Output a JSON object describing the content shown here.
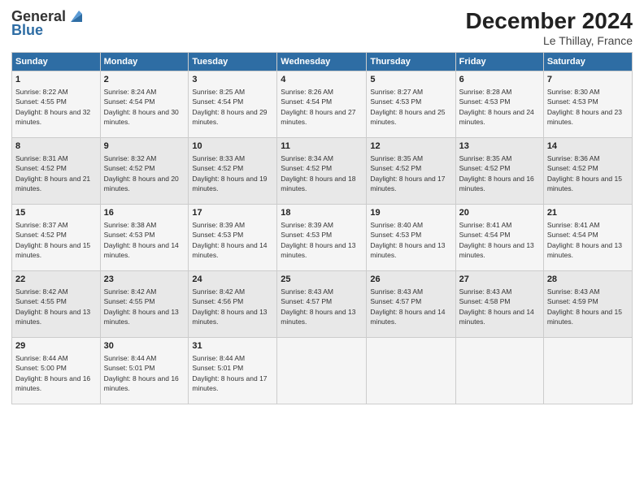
{
  "header": {
    "logo_line1": "General",
    "logo_line2": "Blue",
    "month": "December 2024",
    "location": "Le Thillay, France"
  },
  "weekdays": [
    "Sunday",
    "Monday",
    "Tuesday",
    "Wednesday",
    "Thursday",
    "Friday",
    "Saturday"
  ],
  "weeks": [
    [
      {
        "day": "1",
        "sunrise": "Sunrise: 8:22 AM",
        "sunset": "Sunset: 4:55 PM",
        "daylight": "Daylight: 8 hours and 32 minutes."
      },
      {
        "day": "2",
        "sunrise": "Sunrise: 8:24 AM",
        "sunset": "Sunset: 4:54 PM",
        "daylight": "Daylight: 8 hours and 30 minutes."
      },
      {
        "day": "3",
        "sunrise": "Sunrise: 8:25 AM",
        "sunset": "Sunset: 4:54 PM",
        "daylight": "Daylight: 8 hours and 29 minutes."
      },
      {
        "day": "4",
        "sunrise": "Sunrise: 8:26 AM",
        "sunset": "Sunset: 4:54 PM",
        "daylight": "Daylight: 8 hours and 27 minutes."
      },
      {
        "day": "5",
        "sunrise": "Sunrise: 8:27 AM",
        "sunset": "Sunset: 4:53 PM",
        "daylight": "Daylight: 8 hours and 25 minutes."
      },
      {
        "day": "6",
        "sunrise": "Sunrise: 8:28 AM",
        "sunset": "Sunset: 4:53 PM",
        "daylight": "Daylight: 8 hours and 24 minutes."
      },
      {
        "day": "7",
        "sunrise": "Sunrise: 8:30 AM",
        "sunset": "Sunset: 4:53 PM",
        "daylight": "Daylight: 8 hours and 23 minutes."
      }
    ],
    [
      {
        "day": "8",
        "sunrise": "Sunrise: 8:31 AM",
        "sunset": "Sunset: 4:52 PM",
        "daylight": "Daylight: 8 hours and 21 minutes."
      },
      {
        "day": "9",
        "sunrise": "Sunrise: 8:32 AM",
        "sunset": "Sunset: 4:52 PM",
        "daylight": "Daylight: 8 hours and 20 minutes."
      },
      {
        "day": "10",
        "sunrise": "Sunrise: 8:33 AM",
        "sunset": "Sunset: 4:52 PM",
        "daylight": "Daylight: 8 hours and 19 minutes."
      },
      {
        "day": "11",
        "sunrise": "Sunrise: 8:34 AM",
        "sunset": "Sunset: 4:52 PM",
        "daylight": "Daylight: 8 hours and 18 minutes."
      },
      {
        "day": "12",
        "sunrise": "Sunrise: 8:35 AM",
        "sunset": "Sunset: 4:52 PM",
        "daylight": "Daylight: 8 hours and 17 minutes."
      },
      {
        "day": "13",
        "sunrise": "Sunrise: 8:35 AM",
        "sunset": "Sunset: 4:52 PM",
        "daylight": "Daylight: 8 hours and 16 minutes."
      },
      {
        "day": "14",
        "sunrise": "Sunrise: 8:36 AM",
        "sunset": "Sunset: 4:52 PM",
        "daylight": "Daylight: 8 hours and 15 minutes."
      }
    ],
    [
      {
        "day": "15",
        "sunrise": "Sunrise: 8:37 AM",
        "sunset": "Sunset: 4:52 PM",
        "daylight": "Daylight: 8 hours and 15 minutes."
      },
      {
        "day": "16",
        "sunrise": "Sunrise: 8:38 AM",
        "sunset": "Sunset: 4:53 PM",
        "daylight": "Daylight: 8 hours and 14 minutes."
      },
      {
        "day": "17",
        "sunrise": "Sunrise: 8:39 AM",
        "sunset": "Sunset: 4:53 PM",
        "daylight": "Daylight: 8 hours and 14 minutes."
      },
      {
        "day": "18",
        "sunrise": "Sunrise: 8:39 AM",
        "sunset": "Sunset: 4:53 PM",
        "daylight": "Daylight: 8 hours and 13 minutes."
      },
      {
        "day": "19",
        "sunrise": "Sunrise: 8:40 AM",
        "sunset": "Sunset: 4:53 PM",
        "daylight": "Daylight: 8 hours and 13 minutes."
      },
      {
        "day": "20",
        "sunrise": "Sunrise: 8:41 AM",
        "sunset": "Sunset: 4:54 PM",
        "daylight": "Daylight: 8 hours and 13 minutes."
      },
      {
        "day": "21",
        "sunrise": "Sunrise: 8:41 AM",
        "sunset": "Sunset: 4:54 PM",
        "daylight": "Daylight: 8 hours and 13 minutes."
      }
    ],
    [
      {
        "day": "22",
        "sunrise": "Sunrise: 8:42 AM",
        "sunset": "Sunset: 4:55 PM",
        "daylight": "Daylight: 8 hours and 13 minutes."
      },
      {
        "day": "23",
        "sunrise": "Sunrise: 8:42 AM",
        "sunset": "Sunset: 4:55 PM",
        "daylight": "Daylight: 8 hours and 13 minutes."
      },
      {
        "day": "24",
        "sunrise": "Sunrise: 8:42 AM",
        "sunset": "Sunset: 4:56 PM",
        "daylight": "Daylight: 8 hours and 13 minutes."
      },
      {
        "day": "25",
        "sunrise": "Sunrise: 8:43 AM",
        "sunset": "Sunset: 4:57 PM",
        "daylight": "Daylight: 8 hours and 13 minutes."
      },
      {
        "day": "26",
        "sunrise": "Sunrise: 8:43 AM",
        "sunset": "Sunset: 4:57 PM",
        "daylight": "Daylight: 8 hours and 14 minutes."
      },
      {
        "day": "27",
        "sunrise": "Sunrise: 8:43 AM",
        "sunset": "Sunset: 4:58 PM",
        "daylight": "Daylight: 8 hours and 14 minutes."
      },
      {
        "day": "28",
        "sunrise": "Sunrise: 8:43 AM",
        "sunset": "Sunset: 4:59 PM",
        "daylight": "Daylight: 8 hours and 15 minutes."
      }
    ],
    [
      {
        "day": "29",
        "sunrise": "Sunrise: 8:44 AM",
        "sunset": "Sunset: 5:00 PM",
        "daylight": "Daylight: 8 hours and 16 minutes."
      },
      {
        "day": "30",
        "sunrise": "Sunrise: 8:44 AM",
        "sunset": "Sunset: 5:01 PM",
        "daylight": "Daylight: 8 hours and 16 minutes."
      },
      {
        "day": "31",
        "sunrise": "Sunrise: 8:44 AM",
        "sunset": "Sunset: 5:01 PM",
        "daylight": "Daylight: 8 hours and 17 minutes."
      },
      null,
      null,
      null,
      null
    ]
  ]
}
